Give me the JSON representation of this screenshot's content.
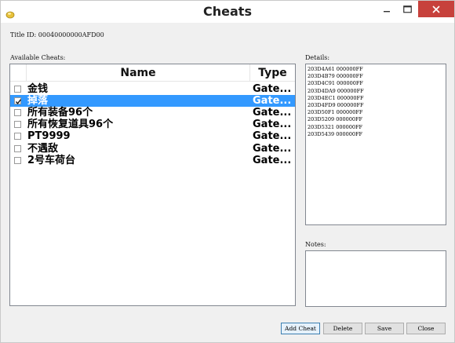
{
  "window": {
    "title": "Cheats"
  },
  "title_id": {
    "text": "Title ID: 00040000000AFD00"
  },
  "available_cheats": {
    "label": "Available Cheats:",
    "columns": {
      "name": "Name",
      "type": "Type"
    },
    "rows": [
      {
        "name": "金钱",
        "type": "Gate...",
        "checked": false,
        "selected": false
      },
      {
        "name": "掉落",
        "type": "Gate...",
        "checked": true,
        "selected": true
      },
      {
        "name": "所有装备96个",
        "type": "Gate...",
        "checked": false,
        "selected": false
      },
      {
        "name": "所有恢复道具96个",
        "type": "Gate...",
        "checked": false,
        "selected": false
      },
      {
        "name": "PT9999",
        "type": "Gate...",
        "checked": false,
        "selected": false
      },
      {
        "name": "不遇敌",
        "type": "Gate...",
        "checked": false,
        "selected": false
      },
      {
        "name": "2号车荷台",
        "type": "Gate...",
        "checked": false,
        "selected": false
      }
    ]
  },
  "details": {
    "label": "Details:",
    "lines": [
      "203D4A61 000000FF",
      "203D4B79 000000FF",
      "203D4C91 000000FF",
      "203D4DA9 000000FF",
      "203D4EC1 000000FF",
      "203D4FD9 000000FF",
      "203D50F1 000000FF",
      "203D5209 000000FF",
      "203D5321 000000FF",
      "203D5439 000000FF"
    ]
  },
  "notes": {
    "label": "Notes:",
    "value": ""
  },
  "buttons": {
    "add_cheat": "Add Cheat",
    "delete": "Delete",
    "save": "Save",
    "close": "Close"
  },
  "colors": {
    "selection": "#3399ff",
    "close_button": "#c7413c"
  }
}
